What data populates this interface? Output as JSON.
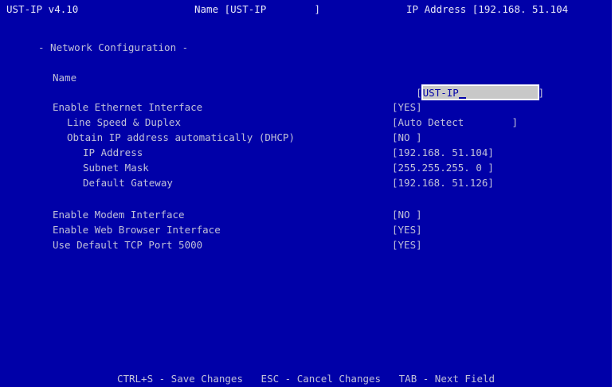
{
  "title_bar": {
    "version": "UST-IP v4.10",
    "name_display": "Name [UST-IP        ]",
    "ip_display": "IP Address [192.168. 51.104"
  },
  "section_title": "- Network Configuration -",
  "fields": {
    "name": {
      "label": "Name",
      "open": "[",
      "value": "UST-IP",
      "close": "]"
    },
    "enable_ethernet": {
      "label": "Enable Ethernet Interface",
      "value": "[YES]"
    },
    "line_speed": {
      "label": "Line Speed & Duplex",
      "value": "[Auto Detect        ]"
    },
    "dhcp": {
      "label": "Obtain IP address automatically (DHCP)",
      "value": "[NO ]"
    },
    "ip_address": {
      "label": "IP Address",
      "value": "[192.168. 51.104]"
    },
    "subnet_mask": {
      "label": "Subnet Mask",
      "value": "[255.255.255. 0 ]"
    },
    "default_gateway": {
      "label": "Default Gateway",
      "value": "[192.168. 51.126]"
    },
    "enable_modem": {
      "label": "Enable Modem Interface",
      "value": "[NO ]"
    },
    "enable_web": {
      "label": "Enable Web Browser Interface",
      "value": "[YES]"
    },
    "default_tcp": {
      "label": "Use Default TCP Port 5000",
      "value": "[YES]"
    }
  },
  "footer": "CTRL+S - Save Changes   ESC - Cancel Changes   TAB - Next Field",
  "colors": {
    "background": "#0000a8",
    "text": "#c0c0d8",
    "input_background": "#c8c8c8"
  }
}
